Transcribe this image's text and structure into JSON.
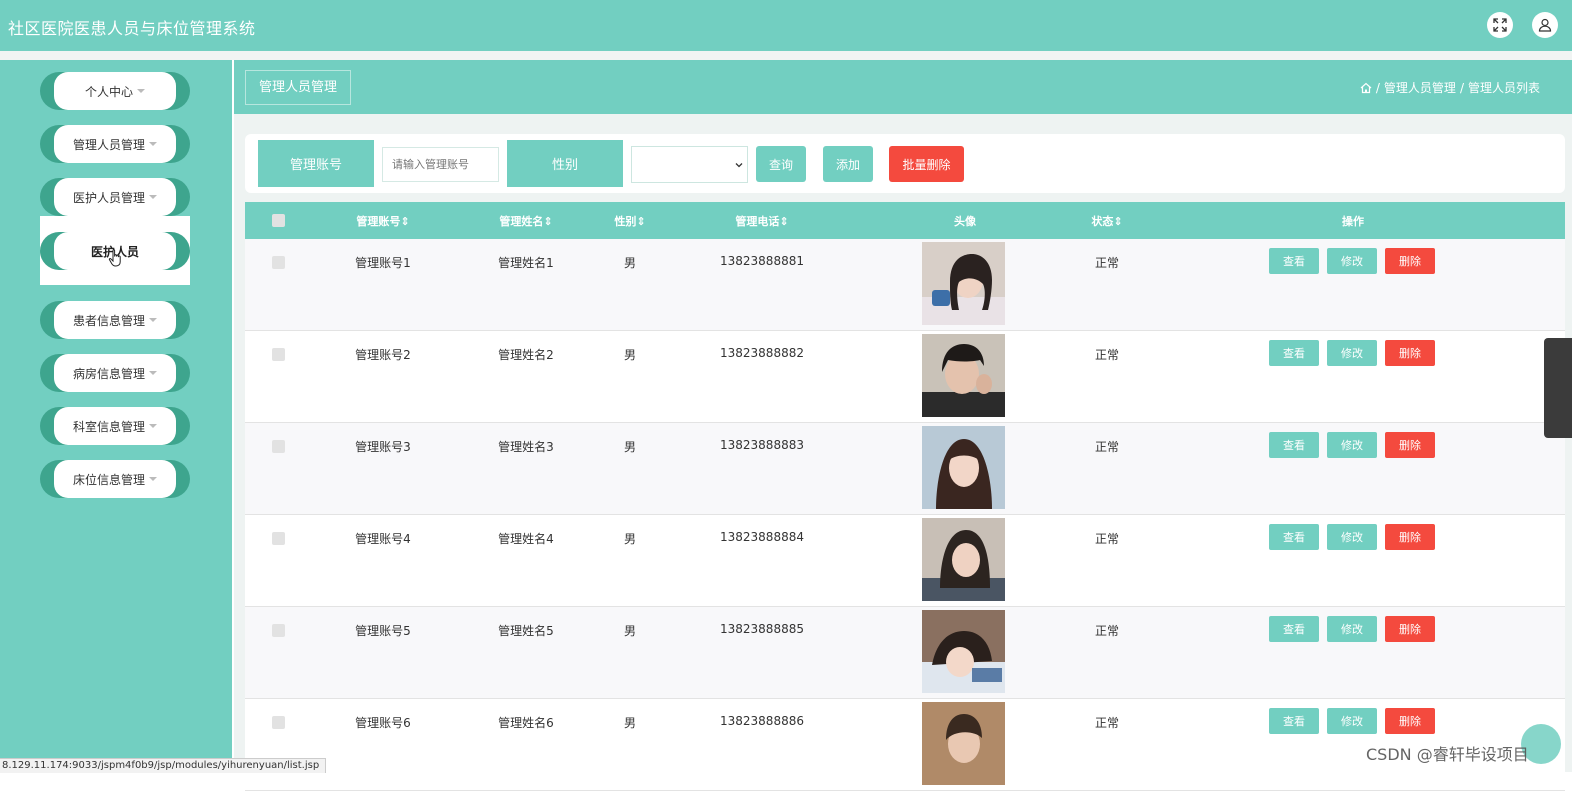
{
  "app": {
    "title": "社区医院医患人员与床位管理系统"
  },
  "header": {
    "fullscreen_icon": "expand-icon",
    "user_icon": "user-icon"
  },
  "sidebar": {
    "items": [
      {
        "label": "个人中心"
      },
      {
        "label": "管理人员管理"
      },
      {
        "label": "医护人员管理"
      },
      {
        "label": "患者信息管理"
      },
      {
        "label": "病房信息管理"
      },
      {
        "label": "科室信息管理"
      },
      {
        "label": "床位信息管理"
      }
    ],
    "submenu_item": "医护人员"
  },
  "page": {
    "title": "管理人员管理",
    "breadcrumb": {
      "home_icon": "home-icon",
      "level1": "管理人员管理",
      "level2": "管理人员列表",
      "sep": "/"
    }
  },
  "search": {
    "account_label": "管理账号",
    "account_placeholder": "请输入管理账号",
    "gender_label": "性别",
    "gender_value": "",
    "query_button": "查询",
    "add_button": "添加",
    "batch_delete_button": "批量删除"
  },
  "table": {
    "columns": [
      "管理账号⇕",
      "管理姓名⇕",
      "性别⇕",
      "管理电话⇕",
      "头像",
      "状态⇕",
      "操作"
    ],
    "rows": [
      {
        "account": "管理账号1",
        "name": "管理姓名1",
        "gender": "男",
        "phone": "13823888881",
        "status": "正常"
      },
      {
        "account": "管理账号2",
        "name": "管理姓名2",
        "gender": "男",
        "phone": "13823888882",
        "status": "正常"
      },
      {
        "account": "管理账号3",
        "name": "管理姓名3",
        "gender": "男",
        "phone": "13823888883",
        "status": "正常"
      },
      {
        "account": "管理账号4",
        "name": "管理姓名4",
        "gender": "男",
        "phone": "13823888884",
        "status": "正常"
      },
      {
        "account": "管理账号5",
        "name": "管理姓名5",
        "gender": "男",
        "phone": "13823888885",
        "status": "正常"
      },
      {
        "account": "管理账号6",
        "name": "管理姓名6",
        "gender": "男",
        "phone": "13823888886",
        "status": "正常"
      }
    ],
    "actions": {
      "view": "查看",
      "edit": "修改",
      "delete": "删除"
    }
  },
  "statusbar": {
    "url": "8.129.11.174:9033/jspm4f0b9/jsp/modules/yihurenyuan/list.jsp"
  },
  "watermark": "CSDN @睿轩毕设项目",
  "colors": {
    "primary": "#72cfc1",
    "sidebar_accent": "#3ea58e",
    "danger": "#f44a3e"
  }
}
